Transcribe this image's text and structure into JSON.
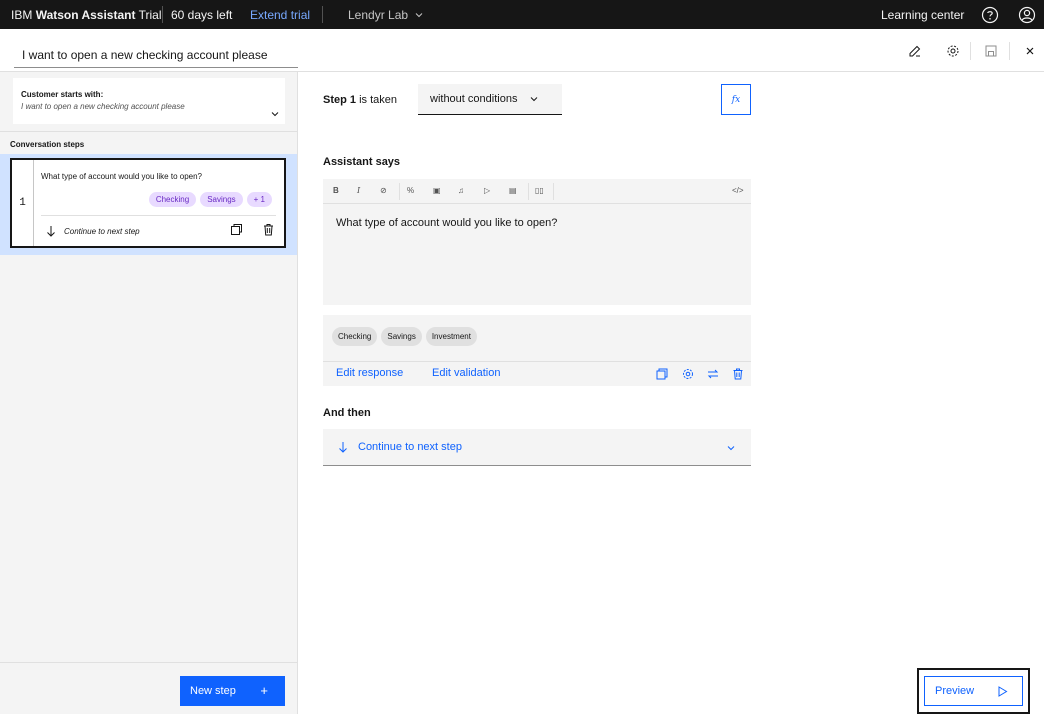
{
  "topbar": {
    "brand_prefix": "IBM",
    "brand_name": "Watson Assistant",
    "plan": "Trial",
    "days_left": "60 days left",
    "extend_trial": "Extend trial",
    "workspace": "Lendyr Lab",
    "learning_center": "Learning center"
  },
  "action": {
    "title": "I want to open a new checking account please"
  },
  "left": {
    "customer_starts_label": "Customer starts with:",
    "customer_starts_value": "I want to open a new checking account please",
    "conversation_steps_label": "Conversation steps",
    "step": {
      "number": "1",
      "title": "What type of account would you like to open?",
      "tags": [
        "Checking",
        "Savings",
        "+ 1"
      ],
      "next": "Continue to next step"
    },
    "new_step": "New step",
    "new_step_plus": "+"
  },
  "main": {
    "step_label_bold": "Step 1",
    "step_label_rest": " is taken",
    "condition": "without conditions",
    "fx": "fx",
    "assistant_says": "Assistant says",
    "toolbar": [
      "B",
      "I",
      "⊘",
      "%",
      "▣",
      "♫",
      "▷",
      "▤",
      "▯▯"
    ],
    "code_icon": "</>",
    "response_text": "What type of account would you like to open?",
    "options": [
      "Checking",
      "Savings",
      "Investment"
    ],
    "edit_response": "Edit response",
    "edit_validation": "Edit validation",
    "and_then": "And then",
    "and_then_value": "Continue to next step",
    "preview": "Preview"
  },
  "colors": {
    "accent": "#0f62fe",
    "tag_bg": "#e8daff",
    "tag_fg": "#6929c4",
    "topbar_bg": "#161616"
  }
}
